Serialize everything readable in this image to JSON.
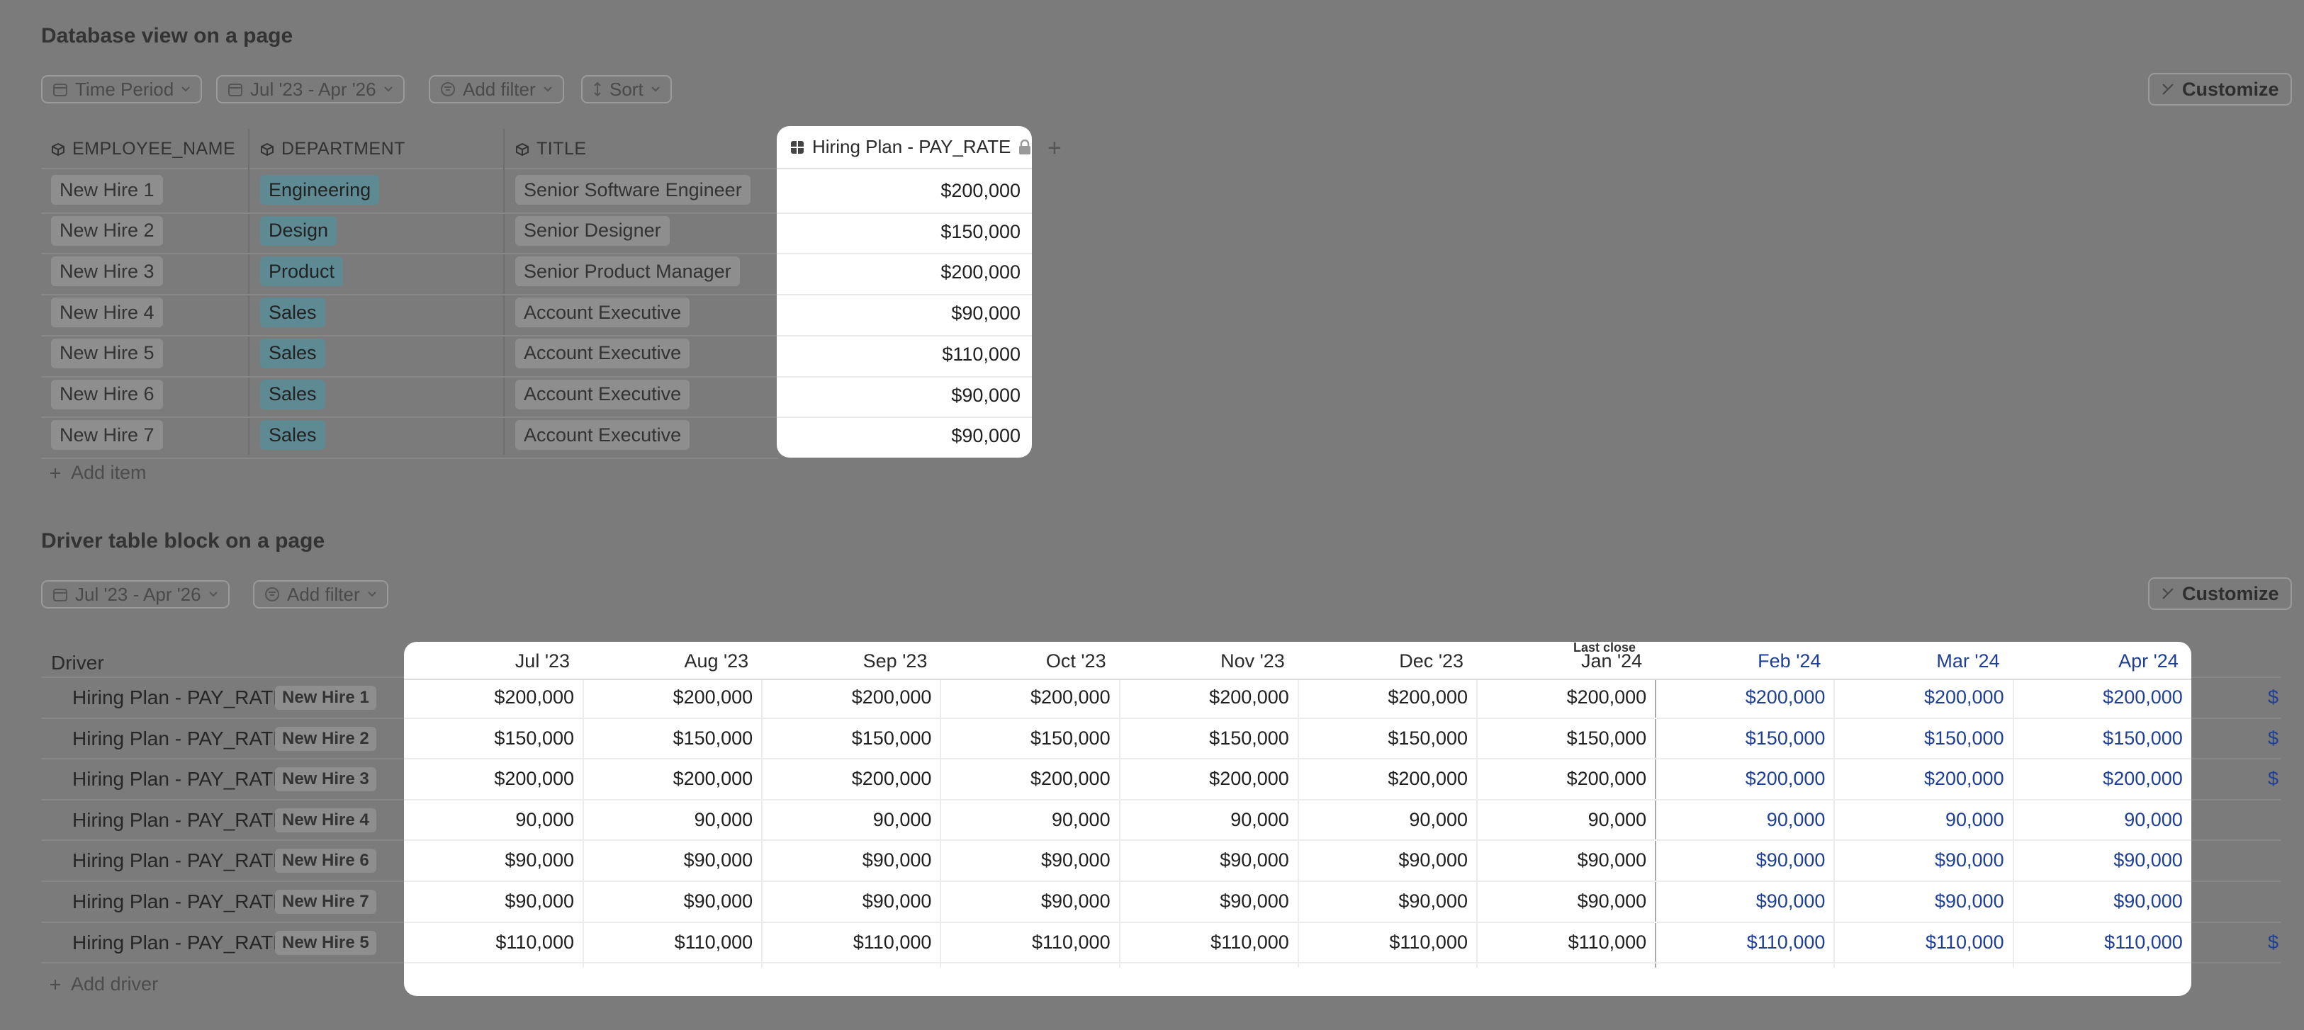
{
  "db_view": {
    "title": "Database view on a page",
    "filters": {
      "time_period": "Time Period",
      "date_range": "Jul '23 - Apr '26",
      "add_filter": "Add filter",
      "sort": "Sort"
    },
    "customize_label": "Customize",
    "columns": {
      "employee_name": "EMPLOYEE_NAME",
      "department": "DEPARTMENT",
      "title": "TITLE",
      "pay_rate": "Hiring Plan - PAY_RATE"
    },
    "add_column_glyph": "+",
    "rows": [
      {
        "name": "New Hire 1",
        "department": "Engineering",
        "title": "Senior Software Engineer",
        "pay_rate": "$200,000"
      },
      {
        "name": "New Hire 2",
        "department": "Design",
        "title": "Senior Designer",
        "pay_rate": "$150,000"
      },
      {
        "name": "New Hire 3",
        "department": "Product",
        "title": "Senior Product Manager",
        "pay_rate": "$200,000"
      },
      {
        "name": "New Hire 4",
        "department": "Sales",
        "title": "Account Executive",
        "pay_rate": "$90,000"
      },
      {
        "name": "New Hire 5",
        "department": "Sales",
        "title": "Account Executive",
        "pay_rate": "$110,000"
      },
      {
        "name": "New Hire 6",
        "department": "Sales",
        "title": "Account Executive",
        "pay_rate": "$90,000"
      },
      {
        "name": "New Hire 7",
        "department": "Sales",
        "title": "Account Executive",
        "pay_rate": "$90,000"
      }
    ],
    "add_item_label": "Add item"
  },
  "driver_table": {
    "title": "Driver table block on a page",
    "filters": {
      "date_range": "Jul '23 - Apr '26",
      "add_filter": "Add filter"
    },
    "customize_label": "Customize",
    "driver_header": "Driver",
    "last_close_label": "Last close",
    "months": [
      "Jul '23",
      "Aug '23",
      "Sep '23",
      "Oct '23",
      "Nov '23",
      "Dec '23",
      "Jan '24",
      "Feb '24",
      "Mar '24",
      "Apr '24"
    ],
    "forecast_start_index": 7,
    "overflow_glyph": "$",
    "rows": [
      {
        "driver": "Hiring Plan - PAY_RATE",
        "hire": "New Hire 1",
        "values": [
          "$200,000",
          "$200,000",
          "$200,000",
          "$200,000",
          "$200,000",
          "$200,000",
          "$200,000",
          "$200,000",
          "$200,000",
          "$200,000"
        ],
        "overflow": true
      },
      {
        "driver": "Hiring Plan - PAY_RATE",
        "hire": "New Hire 2",
        "values": [
          "$150,000",
          "$150,000",
          "$150,000",
          "$150,000",
          "$150,000",
          "$150,000",
          "$150,000",
          "$150,000",
          "$150,000",
          "$150,000"
        ],
        "overflow": true
      },
      {
        "driver": "Hiring Plan - PAY_RATE",
        "hire": "New Hire 3",
        "values": [
          "$200,000",
          "$200,000",
          "$200,000",
          "$200,000",
          "$200,000",
          "$200,000",
          "$200,000",
          "$200,000",
          "$200,000",
          "$200,000"
        ],
        "overflow": true
      },
      {
        "driver": "Hiring Plan - PAY_RATE",
        "hire": "New Hire 4",
        "values": [
          "90,000",
          "90,000",
          "90,000",
          "90,000",
          "90,000",
          "90,000",
          "90,000",
          "90,000",
          "90,000",
          "90,000"
        ],
        "overflow": false
      },
      {
        "driver": "Hiring Plan - PAY_RATE",
        "hire": "New Hire 6",
        "values": [
          "$90,000",
          "$90,000",
          "$90,000",
          "$90,000",
          "$90,000",
          "$90,000",
          "$90,000",
          "$90,000",
          "$90,000",
          "$90,000"
        ],
        "overflow": false
      },
      {
        "driver": "Hiring Plan - PAY_RATE",
        "hire": "New Hire 7",
        "values": [
          "$90,000",
          "$90,000",
          "$90,000",
          "$90,000",
          "$90,000",
          "$90,000",
          "$90,000",
          "$90,000",
          "$90,000",
          "$90,000"
        ],
        "overflow": false
      },
      {
        "driver": "Hiring Plan - PAY_RATE",
        "hire": "New Hire 5",
        "values": [
          "$110,000",
          "$110,000",
          "$110,000",
          "$110,000",
          "$110,000",
          "$110,000",
          "$110,000",
          "$110,000",
          "$110,000",
          "$110,000"
        ],
        "overflow": true
      }
    ],
    "add_driver_label": "Add driver"
  },
  "colors": {
    "background": "#7b7b7b",
    "panel": "#ffffff",
    "forecast_text": "#1e3f94",
    "department_tag": "#5d8a93"
  }
}
